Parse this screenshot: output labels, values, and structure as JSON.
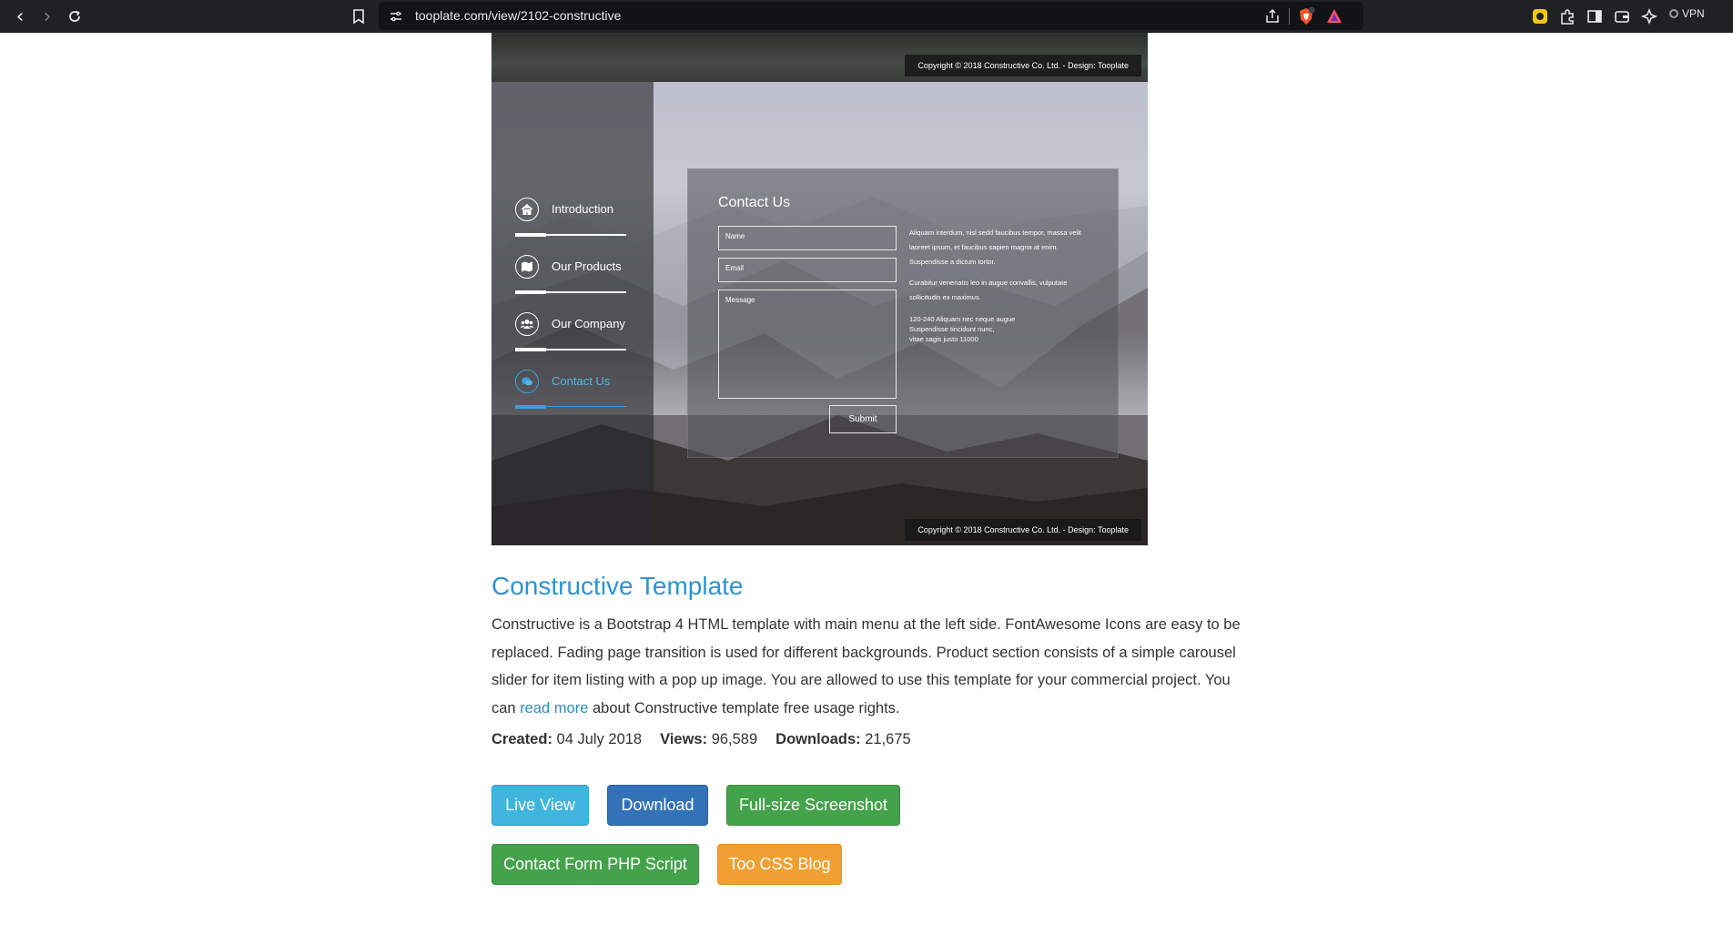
{
  "browser": {
    "url": "tooplate.com/view/2102-constructive",
    "vpn_label": "VPN"
  },
  "preview": {
    "copyright": "Copyright © 2018 Constructive Co. Ltd. - Design: Tooplate",
    "menu": [
      {
        "label": "Introduction",
        "icon": "home-icon"
      },
      {
        "label": "Our Products",
        "icon": "map-icon"
      },
      {
        "label": "Our Company",
        "icon": "users-icon"
      },
      {
        "label": "Contact Us",
        "icon": "comments-icon",
        "active": true
      }
    ],
    "contact": {
      "title": "Contact Us",
      "name_placeholder": "Name",
      "email_placeholder": "Email",
      "message_placeholder": "Message",
      "submit_label": "Submit",
      "info_1": "Aliquam interdum, nisl sedd faucibus tempor, massa velit laoreet ipsum, et faucibus sapien magna at enim. Suspendisse a dictum tortor.",
      "info_2": "Curabitur venenatis leo in augue convallis, vulputate sollicitudin ex maximus.",
      "address_1": "120-240 Aliquam nec neque augue",
      "address_2": "Suspendisse tincidunt nunc,",
      "address_3": "vitae sagis justo 11000"
    }
  },
  "content": {
    "title": "Constructive Template",
    "description_start": "Constructive is a Bootstrap 4 HTML template with main menu at the left side. FontAwesome Icons are easy to be replaced. Fading page transition is used for different backgrounds. Product section consists of a simple carousel slider for item listing with a pop up image. You are allowed to use this template for your commercial project. You can ",
    "read_more_label": "read more",
    "description_end": " about Constructive template free usage rights.",
    "created_label": "Created:",
    "created_value": "04 July 2018",
    "views_label": "Views:",
    "views_value": "96,589",
    "downloads_label": "Downloads:",
    "downloads_value": "21,675"
  },
  "buttons": {
    "live_view": "Live View",
    "download": "Download",
    "full_size": "Full-size Screenshot",
    "contact_php": "Contact Form PHP Script",
    "blog": "Too CSS Blog"
  },
  "colors": {
    "title_blue": "#2d93d4",
    "live_view": "#3fb5de",
    "download": "#3372b7",
    "green": "#44a34a",
    "orange": "#f0a032",
    "menu_active": "#3aa0db"
  }
}
